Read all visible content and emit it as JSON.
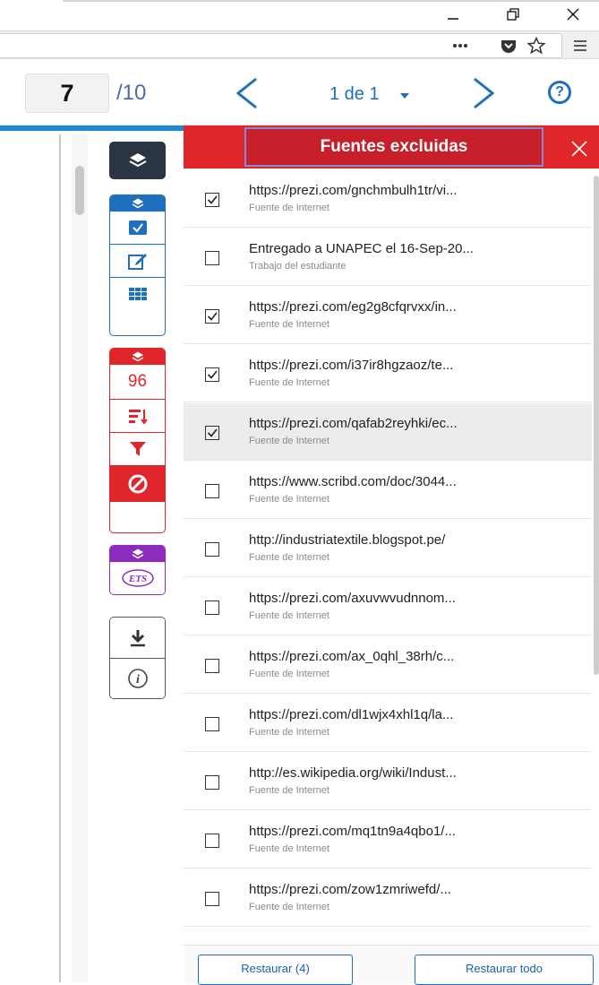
{
  "viewer": {
    "current_page": "7",
    "total_pages": "/10",
    "match_indicator": "1 de 1"
  },
  "tools": {
    "match_count": "96"
  },
  "panel": {
    "title": "Fuentes excluidas",
    "sources": [
      {
        "url": "https://prezi.com/gnchmbulh1tr/vi...",
        "type": "Fuente de Internet",
        "checked": true
      },
      {
        "url": "Entregado a UNAPEC el 16-Sep-20...",
        "type": "Trabajo del estudiante",
        "checked": false
      },
      {
        "url": "https://prezi.com/eg2g8cfqrvxx/in...",
        "type": "Fuente de Internet",
        "checked": true
      },
      {
        "url": "https://prezi.com/i37ir8hgzaoz/te...",
        "type": "Fuente de Internet",
        "checked": true
      },
      {
        "url": "https://prezi.com/qafab2reyhki/ec...",
        "type": "Fuente de Internet",
        "checked": true
      },
      {
        "url": "https://www.scribd.com/doc/3044...",
        "type": "Fuente de Internet",
        "checked": false
      },
      {
        "url": "http://industriatextile.blogspot.pe/",
        "type": "Fuente de Internet",
        "checked": false
      },
      {
        "url": "https://prezi.com/axuvwvudnnom...",
        "type": "Fuente de Internet",
        "checked": false
      },
      {
        "url": "https://prezi.com/ax_0qhl_38rh/c...",
        "type": "Fuente de Internet",
        "checked": false
      },
      {
        "url": "https://prezi.com/dl1wjx4xhl1q/la...",
        "type": "Fuente de Internet",
        "checked": false
      },
      {
        "url": "http://es.wikipedia.org/wiki/Indust...",
        "type": "Fuente de Internet",
        "checked": false
      },
      {
        "url": "https://prezi.com/mq1tn9a4qbo1/...",
        "type": "Fuente de Internet",
        "checked": false
      },
      {
        "url": "https://prezi.com/zow1zmriwefd/...",
        "type": "Fuente de Internet",
        "checked": false
      }
    ],
    "restore_selected_label": "Restaurar (4)",
    "restore_all_label": "Restaurar todo"
  },
  "colors": {
    "accent_blue": "#1f6fbf",
    "excluded_red": "#e0262b",
    "ets_purple": "#8e2bbf",
    "dark_layer": "#2b3442"
  }
}
